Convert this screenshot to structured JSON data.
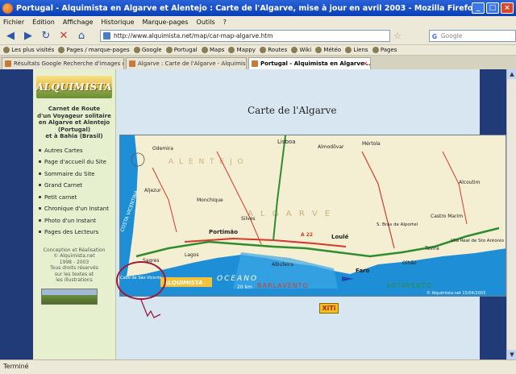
{
  "window": {
    "title": "Portugal - Alquimista en Algarve et Alentejo : Carte de l'Algarve, mise à jour en avril 2003 - Mozilla Firefox"
  },
  "menubar": {
    "items": [
      "Fichier",
      "Édition",
      "Affichage",
      "Historique",
      "Marque-pages",
      "Outils",
      "?"
    ]
  },
  "navbar": {
    "url": "http://www.alquimista.net/map/car-map-algarve.htm",
    "search_placeholder": "Google"
  },
  "bookmarks": {
    "items": [
      "Les plus visités",
      "Pages / marque-pages",
      "Google",
      "Portugal",
      "Maps",
      "Mappy",
      "Routes",
      "Wiki",
      "Météo",
      "Liens",
      "Pages"
    ]
  },
  "tabs": [
    {
      "label": "Résultats Google Recherche d'images c..."
    },
    {
      "label": "Algarve : Carte de l'Algarve - Alquimista"
    },
    {
      "label": "Portugal - Alquimista en Algarve ..."
    }
  ],
  "sidebar": {
    "logo": "ALQUIMISTA",
    "carnet": [
      "Carnet de Route",
      "d'un Voyageur solitaire",
      "en Algarve et Alentejo",
      "(Portugal)",
      "et à Bahia (Brasil)"
    ],
    "menu": [
      {
        "label": "Autres Cartes"
      },
      {
        "label": "Page d'accueil du Site"
      },
      {
        "label": "Sommaire du Site"
      },
      {
        "label": "Grand Carnet"
      },
      {
        "label": "Petit carnet"
      },
      {
        "label": "Chronique d'un Instant"
      },
      {
        "label": "Photo d'un Instant"
      },
      {
        "label": "Pages des Lecteurs"
      }
    ],
    "credits": [
      "Conception et Réalisation",
      "© Alquimista.net",
      "1998 - 2003",
      "Tous droits réservés",
      "sur les textes et",
      "les illustrations"
    ]
  },
  "main": {
    "title": "Carte de l'Algarve",
    "xiti": "XiTi"
  },
  "map": {
    "regions": [
      "A L E N T E J O",
      "A L G A R V E"
    ],
    "sea": "OCEANO",
    "coast_w": "COSTA VICENTINA",
    "west_label": "BARLAVENTO",
    "east_label": "SOTAVENTO",
    "scale": "20 km",
    "copyright": "© Alquimista.net 15/04/2003",
    "logo": "ALQUIMISTA",
    "towns": [
      "Lisboa",
      "Almodôvar",
      "Aljezur",
      "Monchique",
      "Silves",
      "Portimão",
      "Lagos",
      "Albufeira",
      "Loulé",
      "Faro",
      "Olhão",
      "Tavira",
      "Sagres",
      "Vila Real de Sto António",
      "Alcoutim",
      "Mértola",
      "Odemira",
      "S. Brás de Alportel",
      "Castro Marim"
    ],
    "cape": "Cabo de São Vicente",
    "highway": "A 22",
    "colors": {
      "sea": "#1e8fd6",
      "land": "#f4efd2",
      "road": "#2f8c2f",
      "red_road": "#d23b2b"
    }
  },
  "statusbar": {
    "text": "Terminé"
  }
}
